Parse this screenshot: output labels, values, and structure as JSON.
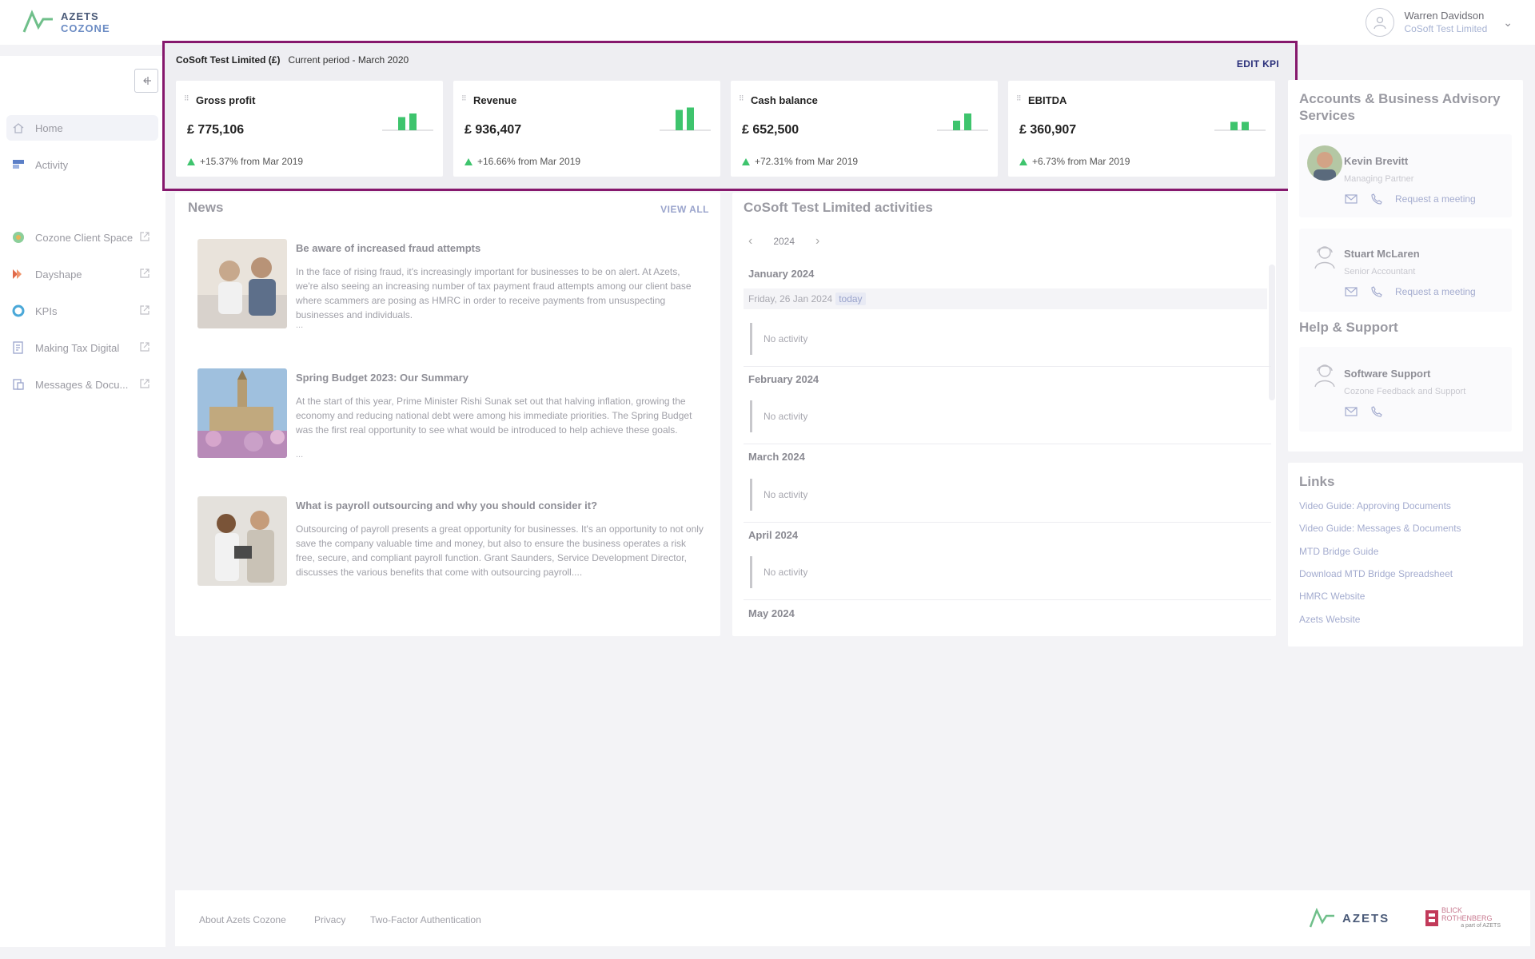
{
  "header": {
    "logo_line1": "AZETS",
    "logo_line2": "COZONE",
    "user_name": "Warren Davidson",
    "user_company": "CoSoft Test Limited"
  },
  "sidebar": {
    "items": [
      {
        "label": "Home",
        "icon": "home-icon"
      },
      {
        "label": "Activity",
        "icon": "activity-icon"
      },
      {
        "label": "Cozone Client Space",
        "icon": "client-space-icon"
      },
      {
        "label": "Dayshape",
        "icon": "dayshape-icon"
      },
      {
        "label": "KPIs",
        "icon": "kpi-icon"
      },
      {
        "label": "Making Tax Digital",
        "icon": "tax-icon"
      },
      {
        "label": "Messages & Docu...",
        "icon": "messages-icon"
      }
    ]
  },
  "kpi": {
    "company": "CoSoft Test Limited (£)",
    "period": "Current period - March 2020",
    "edit_label": "EDIT KPI",
    "accent_color": "#86186d",
    "positive_color": "#3ec46d",
    "cards": [
      {
        "title": "Gross profit",
        "value": "£ 775,106",
        "change": "+15.37% from Mar 2019",
        "spark": [
          0.55,
          0.7
        ]
      },
      {
        "title": "Revenue",
        "value": "£ 936,407",
        "change": "+16.66% from Mar 2019",
        "spark": [
          0.85,
          0.95
        ]
      },
      {
        "title": "Cash balance",
        "value": "£ 652,500",
        "change": "+72.31% from Mar 2019",
        "spark": [
          0.4,
          0.7
        ]
      },
      {
        "title": "EBITDA",
        "value": "£ 360,907",
        "change": "+6.73% from Mar 2019",
        "spark": [
          0.35,
          0.35
        ]
      }
    ]
  },
  "news": {
    "title": "News",
    "view_all": "VIEW ALL",
    "items": [
      {
        "title": "Be aware of increased fraud attempts",
        "body": "In the face of rising fraud, it's increasingly important for businesses to be on alert. At Azets, we're also seeing an increasing number of tax payment fraud attempts among our client base where scammers are posing as HMRC in order to receive payments from unsuspecting businesses and individuals.",
        "more": "..."
      },
      {
        "title": "Spring Budget 2023: Our Summary",
        "body": "At the start of this year, Prime Minister Rishi Sunak set out that halving inflation, growing the economy and reducing national debt were among his immediate priorities. The Spring Budget was the first real opportunity to see what would be introduced to help achieve these goals.",
        "more": "..."
      },
      {
        "title": "What is payroll outsourcing and why you should consider it?",
        "body": "Outsourcing of payroll presents a great opportunity for businesses. It's an opportunity to not only save the company valuable time and money, but also to ensure the business operates a risk free, secure, and compliant payroll function. Grant Saunders, Service Development Director, discusses the various benefits that come with outsourcing payroll....",
        "more": ""
      }
    ]
  },
  "activities": {
    "title": "CoSoft Test Limited activities",
    "year": "2024",
    "months": [
      "January 2024",
      "February 2024",
      "March 2024",
      "April 2024",
      "May 2024"
    ],
    "today_date": "Friday, 26 Jan 2024",
    "today_label": "today",
    "no_activity": "No activity"
  },
  "advisors": {
    "title": "Accounts & Business Advisory Services",
    "contacts": [
      {
        "name": "Kevin Brevitt",
        "role": "Managing Partner",
        "action": "Request a meeting"
      },
      {
        "name": "Stuart McLaren",
        "role": "Senior Accountant",
        "action": "Request a meeting"
      }
    ],
    "help_title": "Help & Support",
    "support": {
      "name": "Software Support",
      "role": "Cozone Feedback and Support"
    }
  },
  "links": {
    "title": "Links",
    "items": [
      "Video Guide: Approving Documents",
      "Video Guide: Messages & Documents",
      "MTD Bridge Guide",
      "Download MTD Bridge Spreadsheet",
      "HMRC Website",
      "Azets Website"
    ]
  },
  "footer": {
    "links": [
      "About Azets Cozone",
      "Privacy",
      "Two-Factor Authentication"
    ],
    "brand": "AZETS",
    "partner": "BLICK ROTHENBERG",
    "partner_sub": "a part of AZETS"
  }
}
